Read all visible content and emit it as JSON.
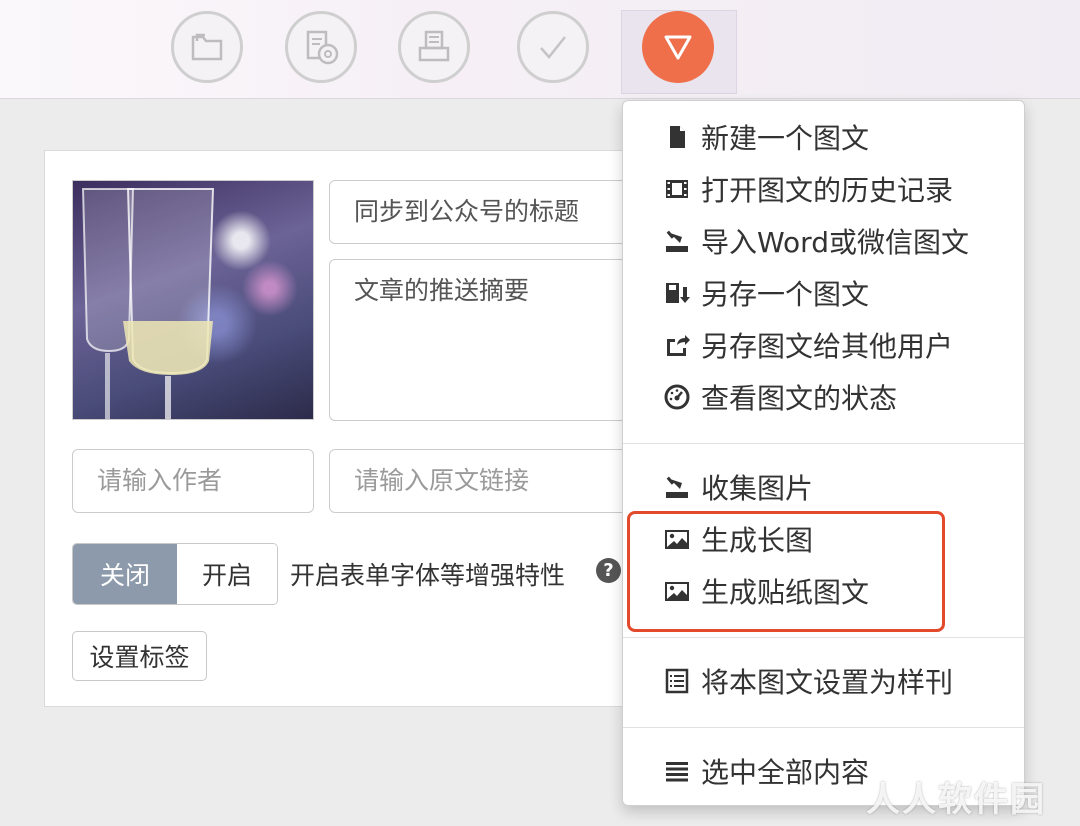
{
  "toolbar": {
    "buttons": [
      {
        "icon": "folder-icon"
      },
      {
        "icon": "document-disc-icon"
      },
      {
        "icon": "printer-icon"
      },
      {
        "icon": "check-icon"
      },
      {
        "icon": "triangle-down-icon",
        "color": "#ef6f4a"
      }
    ]
  },
  "editor": {
    "title_value": "同步到公众号的标题",
    "summary_value": "文章的推送摘要",
    "author_placeholder": "请输入作者",
    "source_link_placeholder": "请输入原文链接",
    "toggle_off_label": "关闭",
    "toggle_on_label": "开启",
    "enhance_label": "开启表单字体等增强特性",
    "help_glyph": "?",
    "tag_button_label": "设置标签"
  },
  "menu": {
    "items": [
      {
        "label": "新建一个图文",
        "icon": "file-icon"
      },
      {
        "label": "打开图文的历史记录",
        "icon": "film-icon"
      },
      {
        "label": "导入Word或微信图文",
        "icon": "import-icon"
      },
      {
        "label": "另存一个图文",
        "icon": "save-as-icon"
      },
      {
        "label": "另存图文给其他用户",
        "icon": "share-icon"
      },
      {
        "label": "查看图文的状态",
        "icon": "dashboard-icon"
      },
      {
        "label": "收集图片",
        "icon": "collect-icon"
      },
      {
        "label": "生成长图",
        "icon": "image-icon"
      },
      {
        "label": "生成贴纸图文",
        "icon": "image-icon"
      },
      {
        "label": "将本图文设置为样刊",
        "icon": "list-icon"
      },
      {
        "label": "选中全部内容",
        "icon": "bars-icon"
      }
    ],
    "highlight_color": "#e24a2b"
  },
  "watermark": "人人软件园"
}
